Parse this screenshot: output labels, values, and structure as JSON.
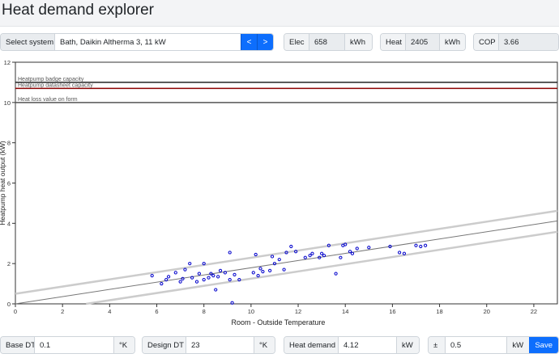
{
  "header": {
    "title": "Heat demand explorer"
  },
  "toolbar": {
    "select_label": "Select system",
    "system_value": "Bath, Daikin Altherma 3, 11 kW",
    "prev_label": "<",
    "next_label": ">",
    "elec_label": "Elec",
    "elec_value": "658",
    "elec_unit": "kWh",
    "heat_label": "Heat",
    "heat_value": "2405",
    "heat_unit": "kWh",
    "cop_label": "COP",
    "cop_value": "3.66"
  },
  "footer": {
    "base_dt_label": "Base DT",
    "base_dt_value": "0.1",
    "base_dt_unit": "°K",
    "design_dt_label": "Design DT",
    "design_dt_value": "23",
    "design_dt_unit": "°K",
    "heat_demand_label": "Heat demand",
    "heat_demand_value": "4.12",
    "heat_demand_unit": "kW",
    "pm_label": "±",
    "pm_value": "0.5",
    "pm_unit": "kW",
    "save_label": "Save"
  },
  "colors": {
    "accent": "#0d6efd",
    "points": "#0000cc",
    "badge_line": "#222222",
    "datasheet_line": "#8b0000",
    "heatloss_line": "#555555",
    "band_line": "#cccccc",
    "center_line": "#777777"
  },
  "chart_data": {
    "type": "scatter",
    "xlabel": "Room - Outside Temperature",
    "ylabel": "Heatpump heat output (kW)",
    "xlim": [
      0,
      23
    ],
    "ylim": [
      0,
      12
    ],
    "xticks": [
      0,
      2,
      4,
      6,
      8,
      10,
      12,
      14,
      16,
      18,
      20,
      22
    ],
    "yticks": [
      0,
      2,
      4,
      6,
      8,
      10,
      12
    ],
    "grid": false,
    "reference_lines": [
      {
        "label": "Heatpump badge capacity",
        "y": 11.0,
        "color": "#222222"
      },
      {
        "label": "Heatpump datasheet capacity",
        "y": 10.7,
        "color": "#8b0000"
      },
      {
        "label": "Heat loss value on form",
        "y": 10.0,
        "color": "#555555"
      }
    ],
    "trend_lines": [
      {
        "kind": "upper",
        "x": [
          0,
          23
        ],
        "y": [
          0.5,
          4.62
        ]
      },
      {
        "kind": "center",
        "x": [
          0,
          23
        ],
        "y": [
          0.0,
          4.12
        ]
      },
      {
        "kind": "lower",
        "x": [
          3,
          23
        ],
        "y": [
          0.0,
          3.58
        ]
      }
    ],
    "points": [
      [
        5.8,
        1.4
      ],
      [
        6.2,
        1.0
      ],
      [
        6.4,
        1.2
      ],
      [
        6.5,
        1.35
      ],
      [
        6.8,
        1.55
      ],
      [
        7.0,
        1.1
      ],
      [
        7.1,
        1.25
      ],
      [
        7.2,
        1.7
      ],
      [
        7.4,
        2.0
      ],
      [
        7.5,
        1.3
      ],
      [
        7.7,
        1.1
      ],
      [
        7.8,
        1.5
      ],
      [
        8.0,
        2.0
      ],
      [
        8.0,
        1.2
      ],
      [
        8.2,
        1.3
      ],
      [
        8.3,
        1.5
      ],
      [
        8.4,
        1.4
      ],
      [
        8.5,
        0.7
      ],
      [
        8.6,
        1.35
      ],
      [
        8.7,
        1.65
      ],
      [
        8.9,
        1.55
      ],
      [
        9.1,
        1.2
      ],
      [
        9.1,
        2.55
      ],
      [
        9.2,
        0.05
      ],
      [
        9.3,
        1.45
      ],
      [
        9.5,
        1.2
      ],
      [
        10.1,
        1.55
      ],
      [
        10.2,
        2.45
      ],
      [
        10.3,
        1.4
      ],
      [
        10.4,
        1.75
      ],
      [
        10.5,
        1.6
      ],
      [
        10.8,
        1.65
      ],
      [
        10.9,
        2.35
      ],
      [
        11.0,
        2.0
      ],
      [
        11.2,
        2.2
      ],
      [
        11.4,
        1.7
      ],
      [
        11.5,
        2.55
      ],
      [
        11.7,
        2.85
      ],
      [
        11.9,
        2.6
      ],
      [
        12.3,
        2.3
      ],
      [
        12.5,
        2.4
      ],
      [
        12.6,
        2.5
      ],
      [
        12.9,
        2.3
      ],
      [
        13.0,
        2.5
      ],
      [
        13.1,
        2.4
      ],
      [
        13.3,
        2.9
      ],
      [
        13.6,
        1.5
      ],
      [
        13.8,
        2.3
      ],
      [
        13.9,
        2.9
      ],
      [
        14.0,
        2.95
      ],
      [
        14.2,
        2.6
      ],
      [
        14.3,
        2.5
      ],
      [
        14.5,
        2.75
      ],
      [
        15.0,
        2.8
      ],
      [
        15.9,
        2.85
      ],
      [
        16.3,
        2.55
      ],
      [
        16.5,
        2.5
      ],
      [
        17.0,
        2.9
      ],
      [
        17.2,
        2.85
      ],
      [
        17.4,
        2.9
      ]
    ]
  }
}
